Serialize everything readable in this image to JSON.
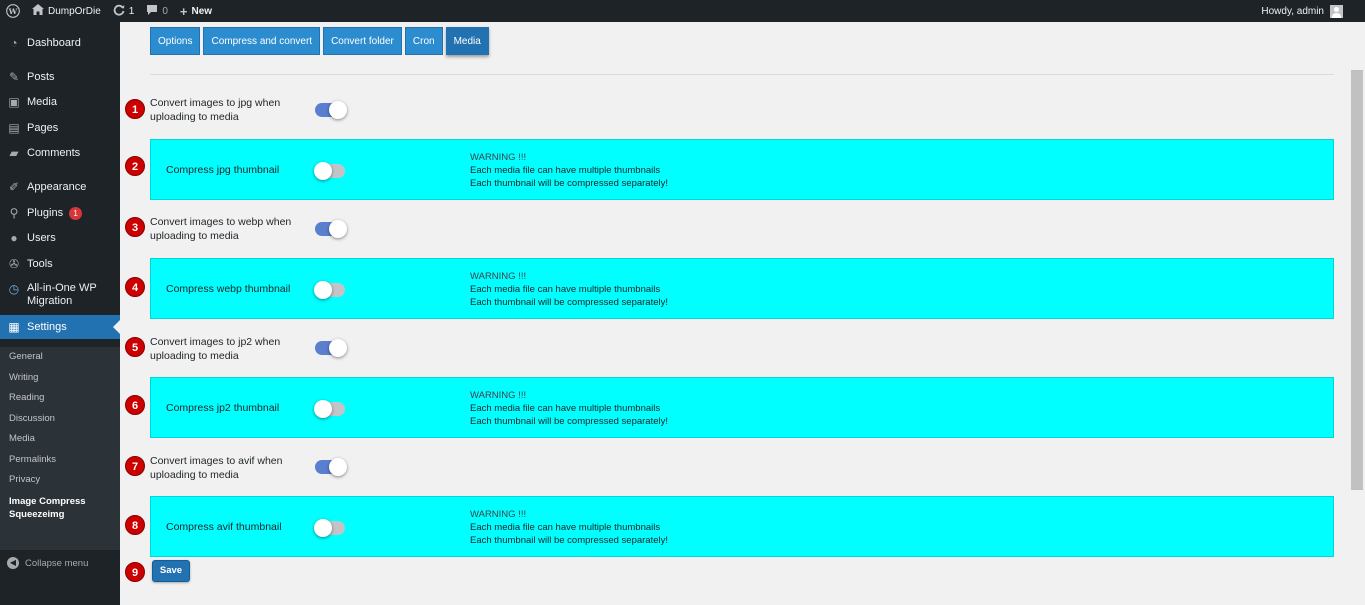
{
  "adminbar": {
    "site_name": "DumpOrDie",
    "updates_count": "1",
    "comments_count": "0",
    "new_label": "New",
    "howdy": "Howdy, admin"
  },
  "sidebar": {
    "items": [
      {
        "icon": "dashboard-icon",
        "label": "Dashboard"
      },
      {
        "icon": "pushpin-icon",
        "label": "Posts"
      },
      {
        "icon": "media-icon",
        "label": "Media"
      },
      {
        "icon": "pages-icon",
        "label": "Pages"
      },
      {
        "icon": "comments-icon",
        "label": "Comments"
      },
      {
        "icon": "appearance-icon",
        "label": "Appearance"
      },
      {
        "icon": "plugins-icon",
        "label": "Plugins",
        "badge": "1"
      },
      {
        "icon": "users-icon",
        "label": "Users"
      },
      {
        "icon": "tools-icon",
        "label": "Tools"
      },
      {
        "icon": "migration-icon",
        "label": "All-in-One WP Migration"
      },
      {
        "icon": "settings-icon",
        "label": "Settings"
      }
    ],
    "submenu": [
      "General",
      "Writing",
      "Reading",
      "Discussion",
      "Media",
      "Permalinks",
      "Privacy",
      "Image Compress Squeezeimg"
    ],
    "collapse_label": "Collapse menu"
  },
  "tabs": [
    "Options",
    "Compress and convert",
    "Convert folder",
    "Cron",
    "Media"
  ],
  "active_tab": "Media",
  "rows": [
    {
      "num": "1",
      "label": "Convert images to jpg when uploading to media",
      "enabled": true
    },
    {
      "num": "2",
      "label": "Compress jpg thumbnail",
      "enabled": false,
      "warning": [
        "WARNING !!!",
        "Each media file can have multiple thumbnails",
        "Each thumbnail will be compressed separately!"
      ]
    },
    {
      "num": "3",
      "label": "Convert images to webp when uploading to media",
      "enabled": true
    },
    {
      "num": "4",
      "label": "Compress webp thumbnail",
      "enabled": false,
      "warning": [
        "WARNING !!!",
        "Each media file can have multiple thumbnails",
        "Each thumbnail will be compressed separately!"
      ]
    },
    {
      "num": "5",
      "label": "Convert images to jp2 when uploading to media",
      "enabled": true
    },
    {
      "num": "6",
      "label": "Compress jp2 thumbnail",
      "enabled": false,
      "warning": [
        "WARNING !!!",
        "Each media file can have multiple thumbnails",
        "Each thumbnail will be compressed separately!"
      ]
    },
    {
      "num": "7",
      "label": "Convert images to avif when uploading to media",
      "enabled": true
    },
    {
      "num": "8",
      "label": "Compress avif thumbnail",
      "enabled": false,
      "warning": [
        "WARNING !!!",
        "Each media file can have multiple thumbnails",
        "Each thumbnail will be compressed separately!"
      ]
    }
  ],
  "save": {
    "num": "9",
    "label": "Save"
  },
  "colors": {
    "panel": "#00ffff",
    "accent": "#2271b1",
    "toggle_on": "#5a7fcf",
    "marker": "#cc0000"
  }
}
